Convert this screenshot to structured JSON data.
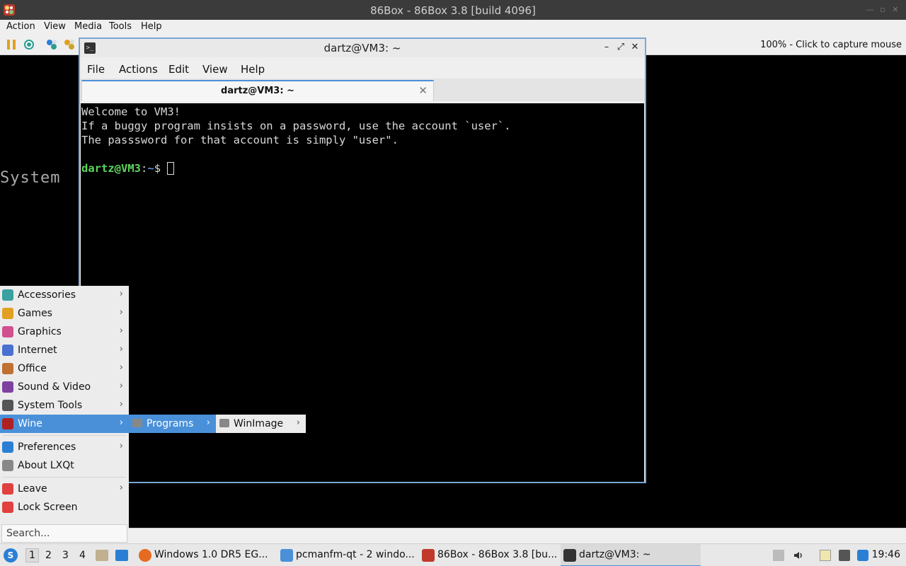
{
  "window": {
    "title": "86Box - 86Box 3.8 [build 4096]",
    "menu": [
      "Action",
      "View",
      "Media",
      "Tools",
      "Help"
    ],
    "status_right": "100% - Click to capture mouse"
  },
  "emulated_screen": {
    "text": "System"
  },
  "terminal": {
    "title": "dartz@VM3: ~",
    "menu": [
      "File",
      "Actions",
      "Edit",
      "View",
      "Help"
    ],
    "tab_title": "dartz@VM3: ~",
    "lines": [
      "Welcome to VM3!",
      "If a buggy program insists on a password, use the account `user`.",
      "The passsword for that account is simply \"user\"."
    ],
    "prompt_user": "dartz@VM3",
    "prompt_sep": ":",
    "prompt_path": "~",
    "prompt_end": "$ "
  },
  "start_menu": {
    "items": [
      {
        "label": "Accessories",
        "icon": "accessories-icon",
        "color": "#3aa0a0"
      },
      {
        "label": "Games",
        "icon": "games-icon",
        "color": "#e0a020"
      },
      {
        "label": "Graphics",
        "icon": "graphics-icon",
        "color": "#d05090"
      },
      {
        "label": "Internet",
        "icon": "internet-icon",
        "color": "#4a70d0"
      },
      {
        "label": "Office",
        "icon": "office-icon",
        "color": "#c07030"
      },
      {
        "label": "Sound & Video",
        "icon": "multimedia-icon",
        "color": "#8040a0"
      },
      {
        "label": "System Tools",
        "icon": "system-tools-icon",
        "color": "#555555"
      },
      {
        "label": "Wine",
        "icon": "wine-icon",
        "color": "#b02020"
      },
      {
        "label": "Preferences",
        "icon": "preferences-icon",
        "color": "#2a7fd4"
      },
      {
        "label": "About LXQt",
        "icon": "info-icon",
        "color": "#888888"
      },
      {
        "label": "Leave",
        "icon": "power-icon",
        "color": "#e04040"
      },
      {
        "label": "Lock Screen",
        "icon": "lock-icon",
        "color": "#e04040"
      }
    ],
    "search_placeholder": "Search...",
    "submenu_programs": "Programs",
    "submenu_winimage": "WinImage"
  },
  "taskbar": {
    "workspaces": [
      "1",
      "2",
      "3",
      "4"
    ],
    "tasks": [
      {
        "label": "Windows 1.0 DR5 EG...",
        "icon": "firefox-icon"
      },
      {
        "label": "pcmanfm-qt - 2 windo...",
        "icon": "folder-icon"
      },
      {
        "label": "86Box - 86Box 3.8 [bu...",
        "icon": "86box-icon"
      },
      {
        "label": "dartz@VM3: ~",
        "icon": "terminal-icon"
      }
    ],
    "clock": "19:46"
  }
}
